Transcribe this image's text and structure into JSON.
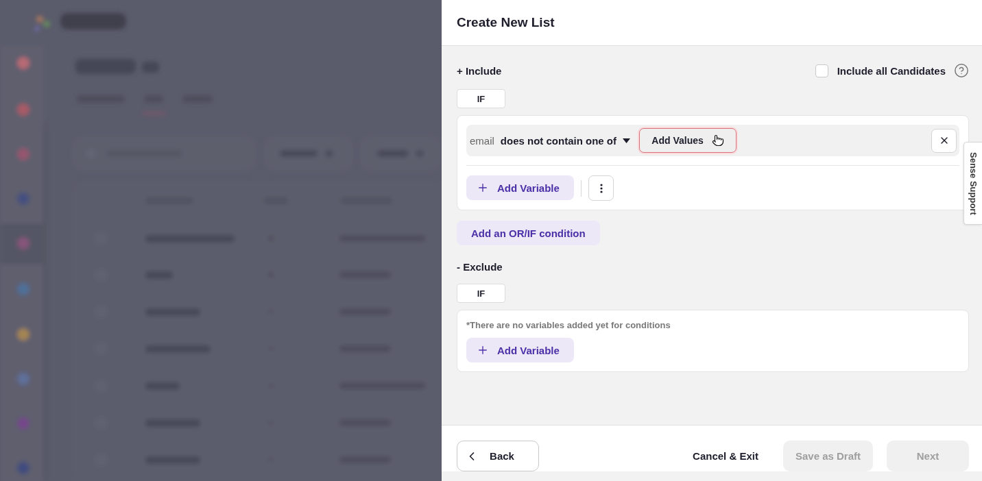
{
  "drawer": {
    "title": "Create New List"
  },
  "include": {
    "heading": "+ Include",
    "all_candidates": {
      "label": "Include all Candidates",
      "checked": false
    },
    "if_label": "IF",
    "conditions": [
      {
        "field": "email",
        "operator": "does not contain one of",
        "values_button": {
          "label": "Add Values",
          "focused": true
        }
      }
    ],
    "add_variable": "Add Variable",
    "add_condition": "Add an OR/IF condition"
  },
  "exclude": {
    "heading": "- Exclude",
    "if_label": "IF",
    "empty_note": "*There are no variables added yet for conditions",
    "add_variable": "Add Variable"
  },
  "support_tab": {
    "label": "Sense Support"
  },
  "footer": {
    "buttons": [
      {
        "kind": "back",
        "label": "Back",
        "disabled": false
      },
      {
        "kind": "text",
        "label": "Cancel & Exit",
        "disabled": false
      },
      {
        "kind": "filled",
        "label": "Save as Draft",
        "disabled": true
      },
      {
        "kind": "filled",
        "label": "Next",
        "disabled": true
      }
    ]
  }
}
